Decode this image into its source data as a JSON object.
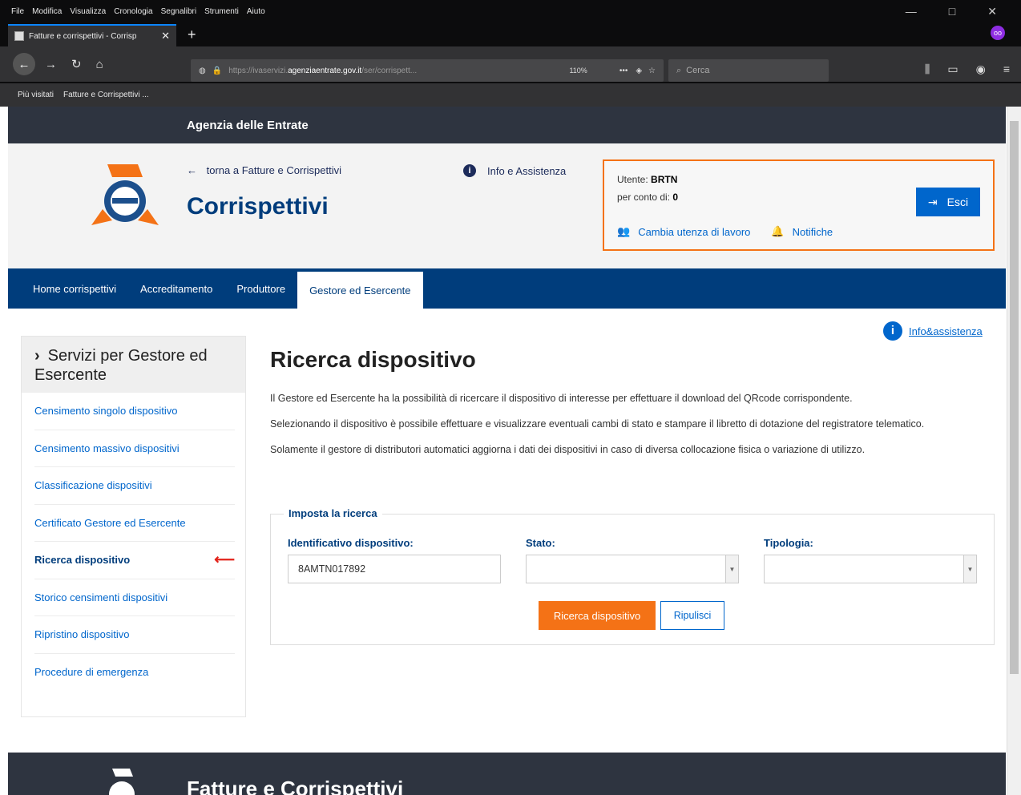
{
  "browser": {
    "menu": [
      "File",
      "Modifica",
      "Visualizza",
      "Cronologia",
      "Segnalibri",
      "Strumenti",
      "Aiuto"
    ],
    "window_controls": [
      "—",
      "□",
      "✕"
    ],
    "tab_title": "Fatture e corrispettivi - Corrisp",
    "tab_close": "✕",
    "new_tab": "+",
    "url_prefix": "https://ivaservizi.",
    "url_host": "agenziaentrate.gov.it",
    "url_suffix": "/ser/corrispett...",
    "zoom": "110%",
    "url_dots": "•••",
    "search_placeholder": "Cerca",
    "bookmarks": [
      "Più visitati",
      "Fatture e Corrispettivi ..."
    ],
    "extension_badge": "oo"
  },
  "site": {
    "agency": "Agenzia delle Entrate",
    "back_link": "torna a Fatture e Corrispettivi",
    "app_title": "Corrispettivi",
    "info_top": "Info e Assistenza"
  },
  "user": {
    "user_label": "Utente:",
    "user_value": "BRTN",
    "on_behalf_label": "per conto di:",
    "on_behalf_value": "0",
    "change_user": "Cambia utenza di lavoro",
    "notifications": "Notifiche",
    "logout": "Esci"
  },
  "nav": {
    "items": [
      "Home corrispettivi",
      "Accreditamento",
      "Produttore",
      "Gestore ed Esercente"
    ],
    "active_index": 3
  },
  "sidebar": {
    "title": "Servizi per Gestore ed Esercente",
    "items": [
      "Censimento singolo dispositivo",
      "Censimento massivo dispositivi",
      "Classificazione dispositivi",
      "Certificato Gestore ed Esercente",
      "Ricerca dispositivo",
      "Storico censimenti dispositivi",
      "Ripristino dispositivo",
      "Procedure di emergenza"
    ],
    "active_index": 4,
    "active_marker": "⟵"
  },
  "content": {
    "info_link": "Info&assistenza",
    "title": "Ricerca dispositivo",
    "paragraphs": [
      "Il Gestore ed Esercente ha la possibilità di ricercare il dispositivo di interesse per effettuare il download del QRcode corrispondente.",
      "Selezionando il dispositivo è possibile effettuare e visualizzare eventuali cambi di stato e stampare il libretto di dotazione del registratore telematico.",
      "Solamente il gestore di distributori automatici aggiorna i dati dei dispositivi in caso di diversa collocazione fisica o variazione di utilizzo."
    ]
  },
  "search_form": {
    "legend": "Imposta la ricerca",
    "device_id_label": "Identificativo dispositivo:",
    "device_id_value": "8AMTN017892",
    "state_label": "Stato:",
    "state_value": "",
    "type_label": "Tipologia:",
    "type_value": "",
    "search_button": "Ricerca dispositivo",
    "clear_button": "Ripulisci"
  },
  "footer": {
    "title": "Fatture e Corrispettivi"
  },
  "colors": {
    "primary_blue": "#003d7c",
    "link_blue": "#0066cc",
    "accent_orange": "#f47216",
    "dark_strip": "#2e3440"
  }
}
